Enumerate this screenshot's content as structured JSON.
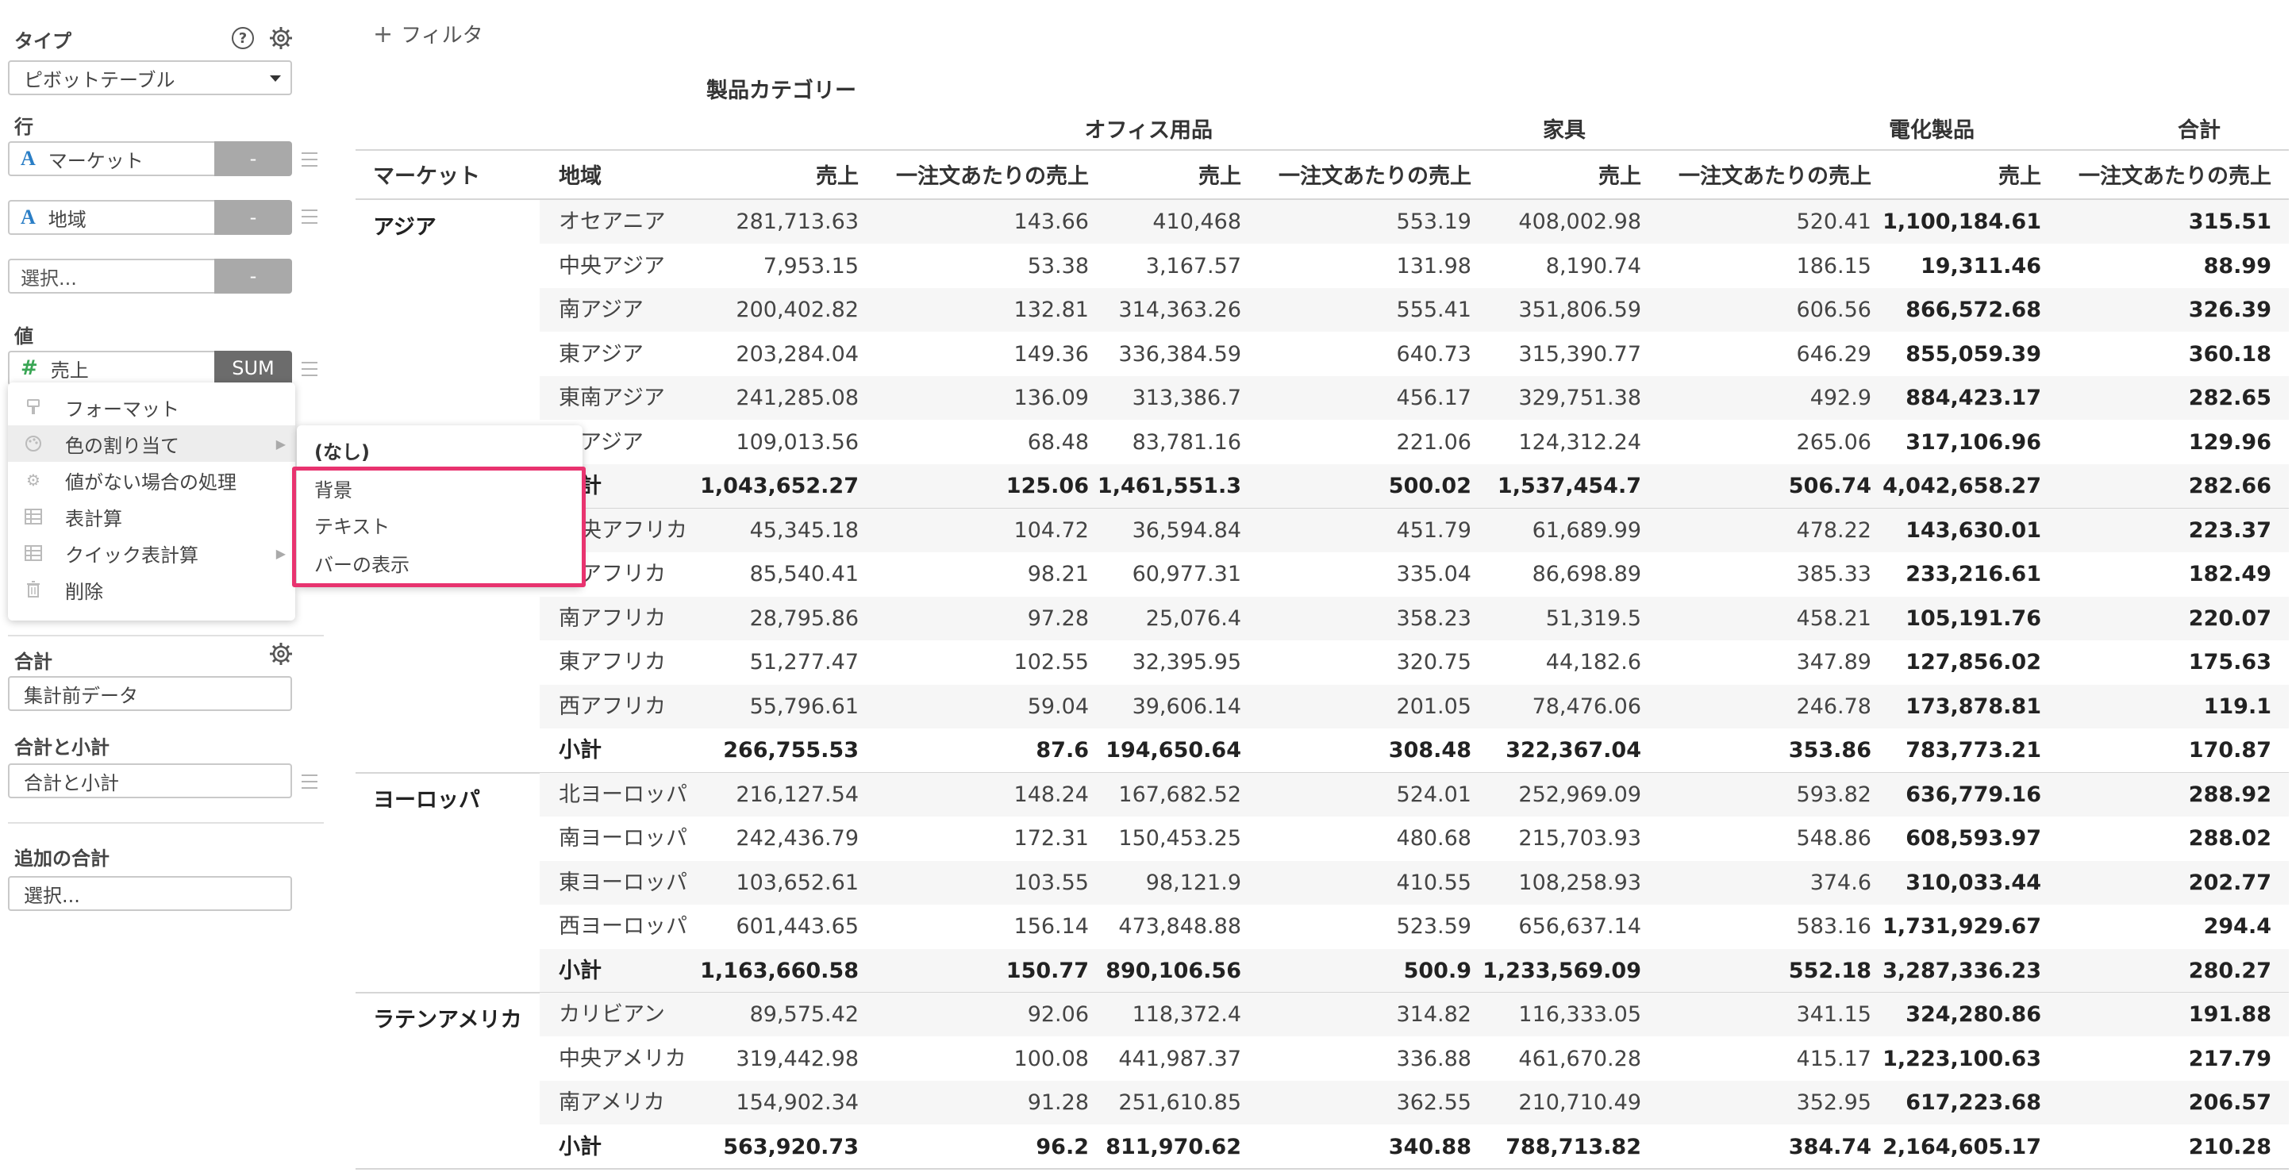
{
  "panel": {
    "type_label": "タイプ",
    "type_value": "ピボットテーブル",
    "rows_label": "行",
    "row_pills": [
      {
        "name": "マーケット",
        "agg": "-"
      },
      {
        "name": "地域",
        "agg": "-"
      }
    ],
    "row_select_placeholder": "選択...",
    "row_select_agg": "-",
    "values_label": "値",
    "value_pill": {
      "name": "売上",
      "agg": "SUM"
    },
    "total_label": "合計",
    "total_value": "集計前データ",
    "subtotal_label": "合計と小計",
    "subtotal_value": "合計と小計",
    "extra_total_label": "追加の合計",
    "extra_total_placeholder": "選択..."
  },
  "context_menu": {
    "items": [
      {
        "label": "フォーマット",
        "icon": "brush-icon"
      },
      {
        "label": "色の割り当て",
        "icon": "palette-icon",
        "has_submenu": true
      },
      {
        "label": "値がない場合の処理",
        "icon": "gear-icon"
      },
      {
        "label": "表計算",
        "icon": "table-icon"
      },
      {
        "label": "クイック表計算",
        "icon": "table-icon",
        "has_submenu": true
      },
      {
        "label": "削除",
        "icon": "trash-icon"
      }
    ],
    "submenu": [
      "(なし)",
      "背景",
      "テキスト",
      "バーの表示"
    ]
  },
  "filter_label": "フィルタ",
  "pivot": {
    "column_dimension": "製品カテゴリー",
    "categories": [
      "オフィス用品",
      "家具",
      "電化製品",
      "合計"
    ],
    "row_headers": [
      "マーケット",
      "地域"
    ],
    "measure_headers": [
      "売上",
      "一注文あたりの売上"
    ],
    "groups": [
      {
        "market": "アジア",
        "rows": [
          {
            "region": "オセアニア",
            "v": [
              "281,713.63",
              "143.66",
              "410,468",
              "553.19",
              "408,002.98",
              "520.41",
              "1,100,184.61",
              "315.51"
            ]
          },
          {
            "region": "中央アジア",
            "v": [
              "7,953.15",
              "53.38",
              "3,167.57",
              "131.98",
              "8,190.74",
              "186.15",
              "19,311.46",
              "88.99"
            ]
          },
          {
            "region": "南アジア",
            "v": [
              "200,402.82",
              "132.81",
              "314,363.26",
              "555.41",
              "351,806.59",
              "606.56",
              "866,572.68",
              "326.39"
            ]
          },
          {
            "region": "東アジア",
            "v": [
              "203,284.04",
              "149.36",
              "336,384.59",
              "640.73",
              "315,390.77",
              "646.29",
              "855,059.39",
              "360.18"
            ]
          },
          {
            "region": "東南アジア",
            "v": [
              "241,285.08",
              "136.09",
              "313,386.7",
              "456.17",
              "329,751.38",
              "492.9",
              "884,423.17",
              "282.65"
            ]
          },
          {
            "region": "西アジア",
            "v": [
              "109,013.56",
              "68.48",
              "83,781.16",
              "221.06",
              "124,312.24",
              "265.06",
              "317,106.96",
              "129.96"
            ]
          },
          {
            "region": "小計",
            "subtotal": true,
            "v": [
              "1,043,652.27",
              "125.06",
              "1,461,551.3",
              "500.02",
              "1,537,454.7",
              "506.74",
              "4,042,658.27",
              "282.66"
            ]
          }
        ]
      },
      {
        "market": "",
        "rows": [
          {
            "region": "中央アフリカ",
            "v": [
              "45,345.18",
              "104.72",
              "36,594.84",
              "451.79",
              "61,689.99",
              "478.22",
              "143,630.01",
              "223.37"
            ]
          },
          {
            "region": "北アフリカ",
            "v": [
              "85,540.41",
              "98.21",
              "60,977.31",
              "335.04",
              "86,698.89",
              "385.33",
              "233,216.61",
              "182.49"
            ]
          },
          {
            "region": "南アフリカ",
            "v": [
              "28,795.86",
              "97.28",
              "25,076.4",
              "358.23",
              "51,319.5",
              "458.21",
              "105,191.76",
              "220.07"
            ]
          },
          {
            "region": "東アフリカ",
            "v": [
              "51,277.47",
              "102.55",
              "32,395.95",
              "320.75",
              "44,182.6",
              "347.89",
              "127,856.02",
              "175.63"
            ]
          },
          {
            "region": "西アフリカ",
            "v": [
              "55,796.61",
              "59.04",
              "39,606.14",
              "201.05",
              "78,476.06",
              "246.78",
              "173,878.81",
              "119.1"
            ]
          },
          {
            "region": "小計",
            "subtotal": true,
            "v": [
              "266,755.53",
              "87.6",
              "194,650.64",
              "308.48",
              "322,367.04",
              "353.86",
              "783,773.21",
              "170.87"
            ]
          }
        ]
      },
      {
        "market": "ヨーロッパ",
        "rows": [
          {
            "region": "北ヨーロッパ",
            "v": [
              "216,127.54",
              "148.24",
              "167,682.52",
              "524.01",
              "252,969.09",
              "593.82",
              "636,779.16",
              "288.92"
            ]
          },
          {
            "region": "南ヨーロッパ",
            "v": [
              "242,436.79",
              "172.31",
              "150,453.25",
              "480.68",
              "215,703.93",
              "548.86",
              "608,593.97",
              "288.02"
            ]
          },
          {
            "region": "東ヨーロッパ",
            "v": [
              "103,652.61",
              "103.55",
              "98,121.9",
              "410.55",
              "108,258.93",
              "374.6",
              "310,033.44",
              "202.77"
            ]
          },
          {
            "region": "西ヨーロッパ",
            "v": [
              "601,443.65",
              "156.14",
              "473,848.88",
              "523.59",
              "656,637.14",
              "583.16",
              "1,731,929.67",
              "294.4"
            ]
          },
          {
            "region": "小計",
            "subtotal": true,
            "v": [
              "1,163,660.58",
              "150.77",
              "890,106.56",
              "500.9",
              "1,233,569.09",
              "552.18",
              "3,287,336.23",
              "280.27"
            ]
          }
        ]
      },
      {
        "market": "ラテンアメリカ",
        "rows": [
          {
            "region": "カリビアン",
            "v": [
              "89,575.42",
              "92.06",
              "118,372.4",
              "314.82",
              "116,333.05",
              "341.15",
              "324,280.86",
              "191.88"
            ]
          },
          {
            "region": "中央アメリカ",
            "v": [
              "319,442.98",
              "100.08",
              "441,987.37",
              "336.88",
              "461,670.28",
              "415.17",
              "1,223,100.63",
              "217.79"
            ]
          },
          {
            "region": "南アメリカ",
            "v": [
              "154,902.34",
              "91.28",
              "251,610.85",
              "362.55",
              "210,710.49",
              "352.95",
              "617,223.68",
              "206.57"
            ]
          },
          {
            "region": "小計",
            "subtotal": true,
            "v": [
              "563,920.73",
              "96.2",
              "811,970.62",
              "340.88",
              "788,713.82",
              "384.74",
              "2,164,605.17",
              "210.28"
            ]
          }
        ]
      }
    ]
  }
}
